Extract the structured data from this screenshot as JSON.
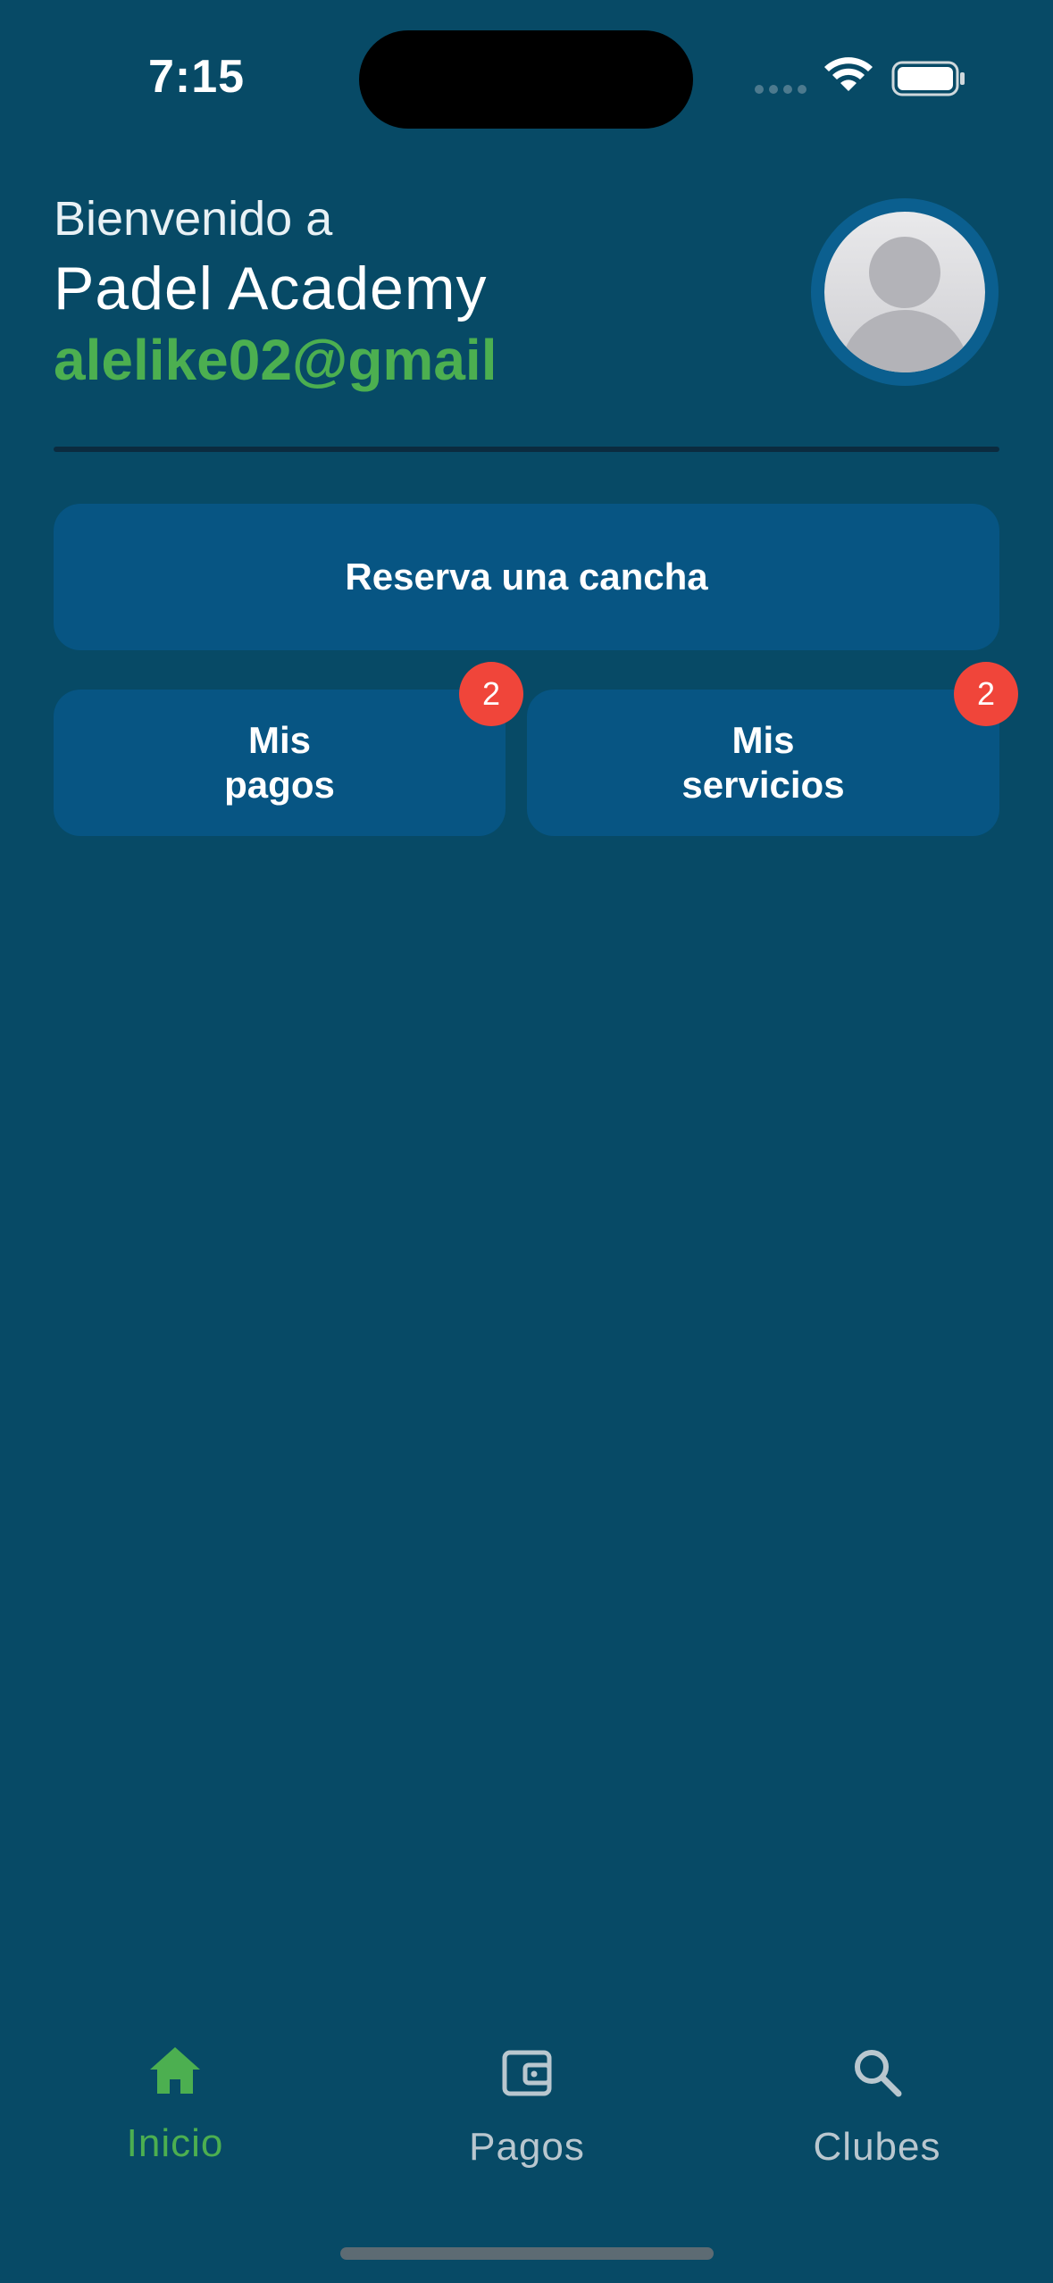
{
  "status_bar": {
    "time": "7:15",
    "icons": [
      "signal-dots-icon",
      "wifi-icon",
      "battery-icon"
    ]
  },
  "header": {
    "welcome": "Bienvenido a",
    "club_name": "Padel Academy",
    "email": "alelike02@gmail",
    "avatar_icon": "person-placeholder-icon"
  },
  "actions": {
    "reserve_label": "Reserva una cancha",
    "pagos_label": "Mis\npagos",
    "pagos_badge": "2",
    "servicios_label": "Mis\nservicios",
    "servicios_badge": "2"
  },
  "tab_bar": {
    "tabs": [
      {
        "label": "Inicio",
        "icon": "home-icon",
        "active": true
      },
      {
        "label": "Pagos",
        "icon": "wallet-icon",
        "active": false
      },
      {
        "label": "Clubes",
        "icon": "search-icon",
        "active": false
      }
    ]
  },
  "colors": {
    "background": "#074a66",
    "button": "#075583",
    "accent_green": "#4caf50",
    "badge_red": "#f0453a"
  }
}
